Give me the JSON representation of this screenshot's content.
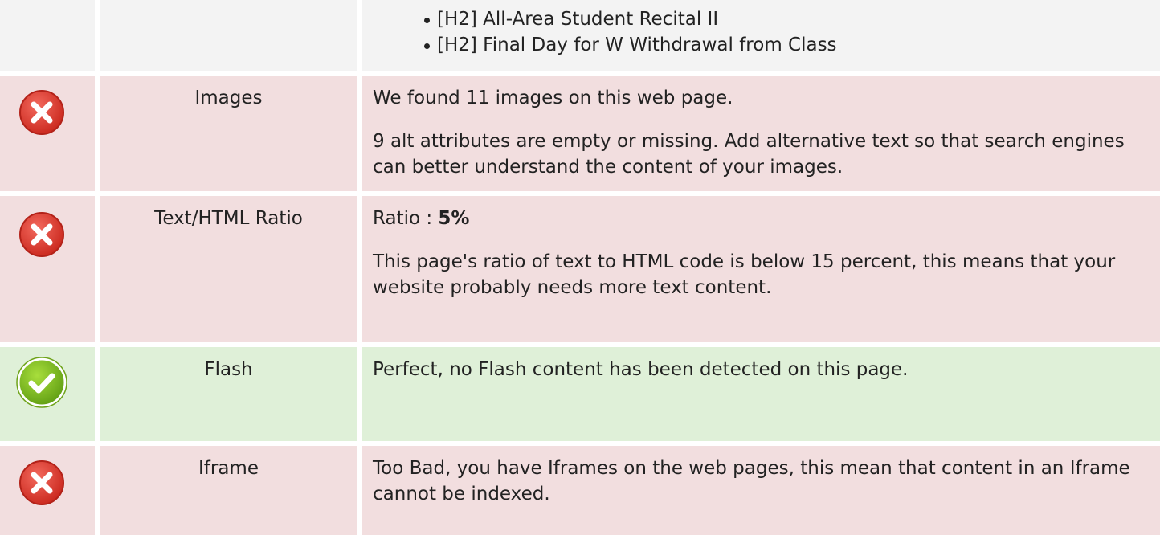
{
  "headings_row": {
    "items": [
      "[H2] All-Area Student Recital II",
      "[H2] Final Day for W Withdrawal from Class"
    ]
  },
  "images": {
    "status": "fail",
    "label": "Images",
    "line1": "We found 11 images on this web page.",
    "line2": "9 alt attributes are empty or missing. Add alternative text so that search engines can better understand the content of your images."
  },
  "ratio": {
    "status": "fail",
    "label": "Text/HTML Ratio",
    "prefix": "Ratio : ",
    "value": "5%",
    "line2": "This page's ratio of text to HTML code is below 15 percent, this means that your website probably needs more text content."
  },
  "flash": {
    "status": "pass",
    "label": "Flash",
    "line1": "Perfect, no Flash content has been detected on this page."
  },
  "iframe": {
    "status": "fail",
    "label": "Iframe",
    "line1": "Too Bad, you have Iframes on the web pages, this mean that content in an Iframe cannot be indexed."
  },
  "colors": {
    "fail_bg": "#f2dedf",
    "pass_bg": "#dff0d8",
    "neutral_bg": "#f3f3f3",
    "fail_icon": "#e03b30",
    "pass_icon": "#7cbf1e"
  },
  "icons": {
    "fail": "error-icon",
    "pass": "check-icon"
  }
}
